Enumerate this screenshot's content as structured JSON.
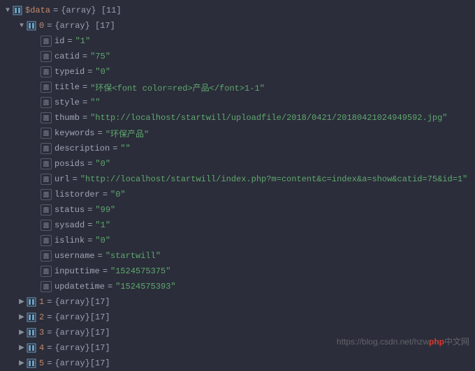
{
  "root": {
    "name": "$data",
    "type": "{array}",
    "count": "[11]"
  },
  "node0": {
    "key": "0",
    "type": "{array}",
    "count": "[17]"
  },
  "fields": [
    {
      "key": "id",
      "value": "\"1\""
    },
    {
      "key": "catid",
      "value": "\"75\""
    },
    {
      "key": "typeid",
      "value": "\"0\""
    },
    {
      "key": "title",
      "value": "\"环保<font color=red>产品</font>1-1\""
    },
    {
      "key": "style",
      "value": "\"\""
    },
    {
      "key": "thumb",
      "value": "\"http://localhost/startwill/uploadfile/2018/0421/20180421024949592.jpg\""
    },
    {
      "key": "keywords",
      "value": "\"环保产品\""
    },
    {
      "key": "description",
      "value": "\"\""
    },
    {
      "key": "posids",
      "value": "\"0\""
    },
    {
      "key": "url",
      "value": "\"http://localhost/startwill/index.php?m=content&c=index&a=show&catid=75&id=1\""
    },
    {
      "key": "listorder",
      "value": "\"0\""
    },
    {
      "key": "status",
      "value": "\"99\""
    },
    {
      "key": "sysadd",
      "value": "\"1\""
    },
    {
      "key": "islink",
      "value": "\"0\""
    },
    {
      "key": "username",
      "value": "\"startwill\""
    },
    {
      "key": "inputtime",
      "value": "\"1524575375\""
    },
    {
      "key": "updatetime",
      "value": "\"1524575393\""
    }
  ],
  "siblings": [
    {
      "key": "1",
      "type": "{array}",
      "count": "[17]"
    },
    {
      "key": "2",
      "type": "{array}",
      "count": "[17]"
    },
    {
      "key": "3",
      "type": "{array}",
      "count": "[17]"
    },
    {
      "key": "4",
      "type": "{array}",
      "count": "[17]"
    },
    {
      "key": "5",
      "type": "{array}",
      "count": "[17]"
    }
  ],
  "eq": "=",
  "watermark_left": "https://blog.csdn.net/hzw",
  "watermark_right": "中文网"
}
